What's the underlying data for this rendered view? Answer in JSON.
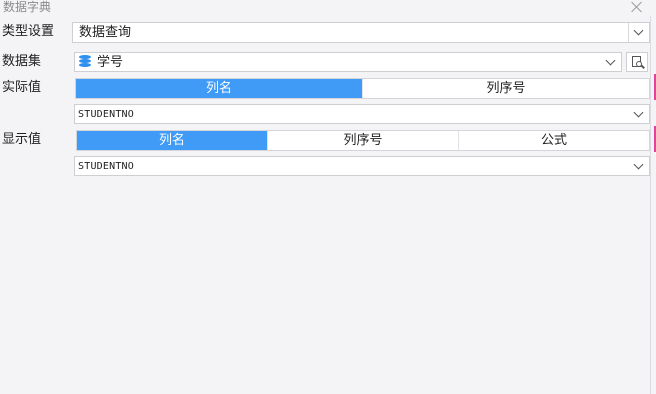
{
  "window": {
    "title": "数据字典"
  },
  "type_setting": {
    "label": "类型设置",
    "value": "数据查询"
  },
  "dataset": {
    "label": "数据集",
    "value": "学号"
  },
  "actual_value": {
    "label": "实际值",
    "tabs": [
      {
        "label": "列名",
        "active": true
      },
      {
        "label": "列序号",
        "active": false
      }
    ],
    "column": "STUDENTNO"
  },
  "display_value": {
    "label": "显示值",
    "tabs": [
      {
        "label": "列名",
        "active": true
      },
      {
        "label": "列序号",
        "active": false
      },
      {
        "label": "公式",
        "active": false
      }
    ],
    "column": "STUDENTNO"
  },
  "colors": {
    "accent": "#3f9bf5",
    "side_marker": "#e0449a",
    "db_icon": "#2f90ee"
  }
}
